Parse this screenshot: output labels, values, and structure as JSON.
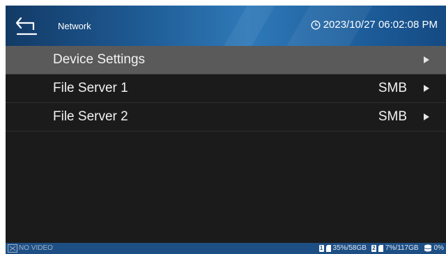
{
  "header": {
    "title": "Network",
    "datetime": "2023/10/27 06:02:08 PM"
  },
  "menu": {
    "items": [
      {
        "label": "Device Settings",
        "value": "",
        "selected": true
      },
      {
        "label": "File Server 1",
        "value": "SMB",
        "selected": false
      },
      {
        "label": "File Server 2",
        "value": "SMB",
        "selected": false
      }
    ]
  },
  "statusbar": {
    "video_status": "NO VIDEO",
    "storage1": {
      "slot": "1",
      "text": "35%/58GB"
    },
    "storage2": {
      "slot": "2",
      "text": "7%/117GB"
    },
    "disk": {
      "text": "0%"
    }
  },
  "colors": {
    "header_accent": "#2f79b8",
    "status_bar": "#1e4f84",
    "selected_row": "#5a5a5a",
    "background": "#1b1b1b"
  }
}
